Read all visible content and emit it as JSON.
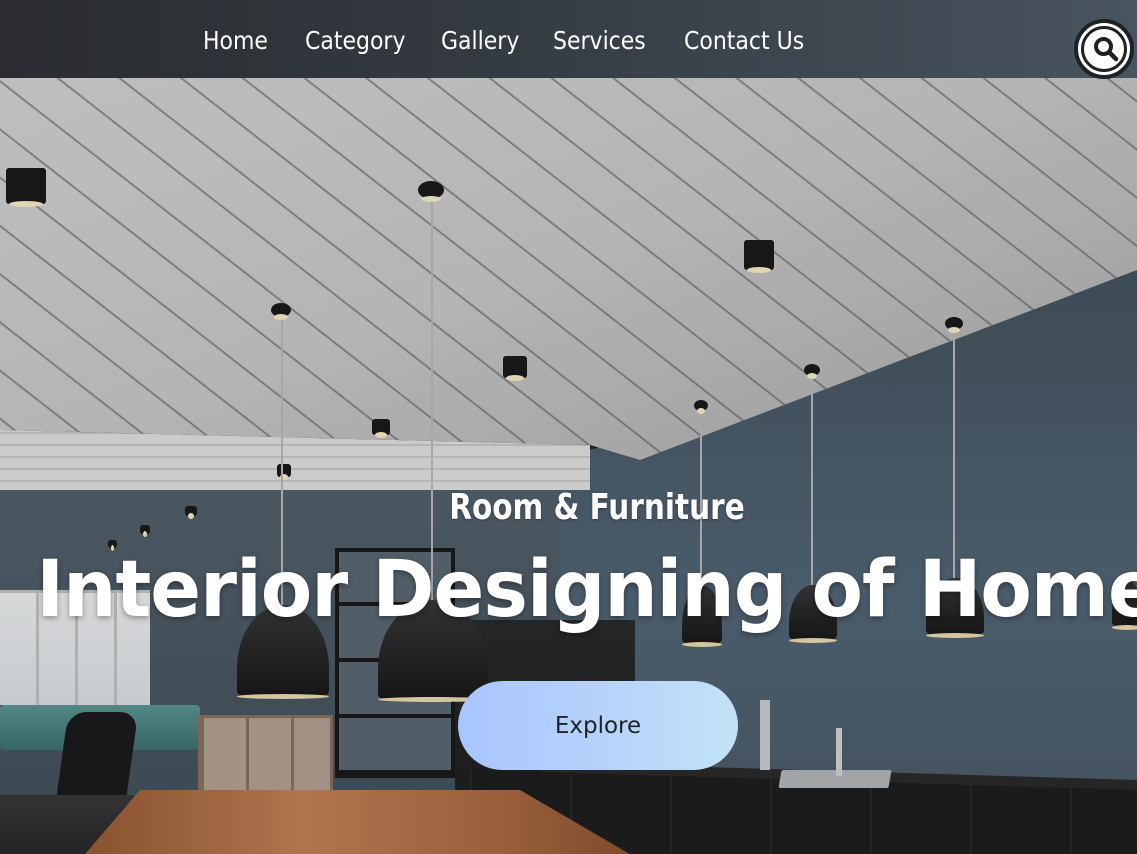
{
  "nav": {
    "links": [
      "Home",
      "Category",
      "Gallery",
      "Services",
      "Contact Us"
    ],
    "search_icon": "search-icon"
  },
  "hero": {
    "subtitle": "Room & Furniture",
    "title": "Interior Designing of Home",
    "cta_label": "Explore",
    "background": "interior kitchen dining photo"
  },
  "colors": {
    "nav_bg": "#353b42",
    "cta_start": "#a9c5ff",
    "cta_end": "#c2e3f6",
    "text": "#ffffff"
  }
}
